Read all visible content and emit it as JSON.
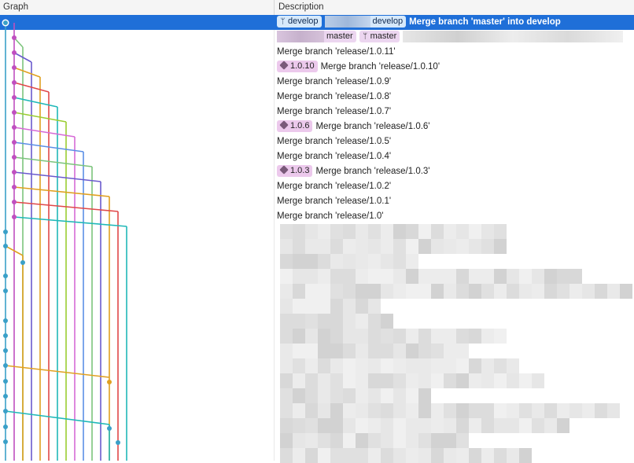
{
  "header": {
    "graph": "Graph",
    "description": "Description"
  },
  "selected": {
    "branch_1": "develop",
    "branch_2": "develop",
    "message": "Merge branch 'master' into develop"
  },
  "row_master": {
    "branch_1": "master",
    "branch_2": "master"
  },
  "commits": [
    {
      "tag": "",
      "message": "Merge branch 'release/1.0.11'"
    },
    {
      "tag": "1.0.10",
      "message": "Merge branch 'release/1.0.10'"
    },
    {
      "tag": "",
      "message": "Merge branch 'release/1.0.9'"
    },
    {
      "tag": "",
      "message": "Merge branch 'release/1.0.8'"
    },
    {
      "tag": "",
      "message": "Merge branch 'release/1.0.7'"
    },
    {
      "tag": "1.0.6",
      "message": "Merge branch 'release/1.0.6'"
    },
    {
      "tag": "",
      "message": "Merge branch 'release/1.0.5'"
    },
    {
      "tag": "",
      "message": "Merge branch 'release/1.0.4'"
    },
    {
      "tag": "1.0.3",
      "message": "Merge branch 'release/1.0.3'"
    },
    {
      "tag": "",
      "message": "Merge branch 'release/1.0.2'"
    },
    {
      "tag": "",
      "message": "Merge branch 'release/1.0.1'"
    },
    {
      "tag": "",
      "message": "Merge branch 'release/1.0'"
    }
  ],
  "graph_colors": [
    "#3aa0c8",
    "#c04fc0",
    "#7cc47c",
    "#6a5acd",
    "#e0a020",
    "#e04848",
    "#20b8b8",
    "#9acd32",
    "#d66ad6",
    "#5b8fe6",
    "#c9c9c9"
  ]
}
